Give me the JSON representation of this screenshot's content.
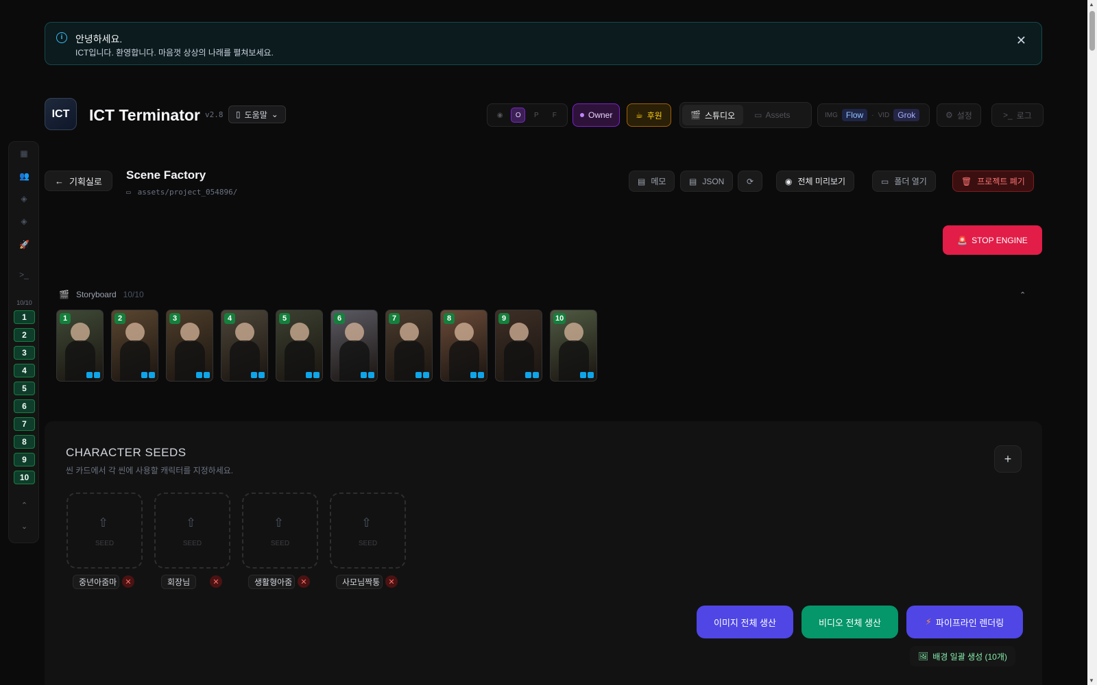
{
  "notice": {
    "title": "안녕하세요.",
    "message": "ICT입니다. 환영합니다. 마음껏 상상의 나래를 펼쳐보세요."
  },
  "header": {
    "logo": "ICT",
    "title": "ICT Terminator",
    "version": "v2.8",
    "help": "도움말",
    "visibility": [
      "O",
      "P",
      "F"
    ],
    "owner": "Owner",
    "donate": "후원",
    "studio": "스튜디오",
    "assets": "Assets",
    "img_label": "IMG",
    "img_model": "Flow",
    "vid_label": "VID",
    "vid_model": "Grok",
    "settings": "설정",
    "log": "로그"
  },
  "sidebar": {
    "count": "10/10",
    "scenes": [
      "1",
      "2",
      "3",
      "4",
      "5",
      "6",
      "7",
      "8",
      "9",
      "10"
    ]
  },
  "project": {
    "back": "기획실로",
    "title": "Scene Factory",
    "path": "assets/project_054896/",
    "memo": "메모",
    "json": "JSON",
    "preview": "전체 미리보기",
    "open_folder": "폴더 열기",
    "discard": "프로젝트 폐기",
    "stop": "STOP ENGINE"
  },
  "storyboard": {
    "label": "Storyboard",
    "count": "10/10",
    "frames": [
      "1",
      "2",
      "3",
      "4",
      "5",
      "6",
      "7",
      "8",
      "9",
      "10"
    ]
  },
  "seeds": {
    "title": "CHARACTER SEEDS",
    "subtitle": "씬 카드에서 각 씬에 사용할 캐릭터를 지정하세요.",
    "slot_label": "SEED",
    "names": [
      "중년아줌마",
      "회장님",
      "생활형아줌",
      "사모님짝퉁"
    ]
  },
  "actions": {
    "image_all": "이미지 전체 생산",
    "video_all": "비디오 전체 생산",
    "pipeline": "파이프라인 렌더링",
    "background": "배경 일괄 생성 (10개)"
  },
  "colors": {
    "accent_indigo": "#4f46e5",
    "accent_green": "#059669",
    "stop_red": "#e11d48"
  }
}
